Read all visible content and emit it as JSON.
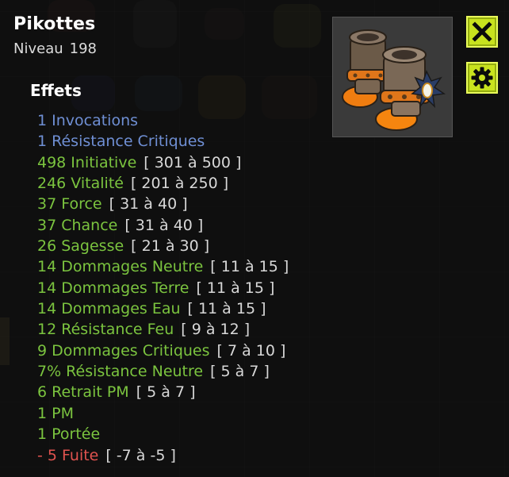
{
  "character": {
    "name": "Pikottes",
    "level_label": "Niveau",
    "level_value": "198"
  },
  "effects_title": "Effets",
  "effects": [
    {
      "text": "1 Invocations",
      "range": "",
      "color": "blue"
    },
    {
      "text": "1 Résistance Critiques",
      "range": "",
      "color": "blue"
    },
    {
      "text": "498 Initiative",
      "range": "[ 301 à 500 ]",
      "color": "green"
    },
    {
      "text": "246 Vitalité",
      "range": "[ 201 à 250 ]",
      "color": "green"
    },
    {
      "text": "37 Force",
      "range": "[ 31 à 40 ]",
      "color": "green"
    },
    {
      "text": "37 Chance",
      "range": "[ 31 à 40 ]",
      "color": "green"
    },
    {
      "text": "26 Sagesse",
      "range": "[ 21 à 30 ]",
      "color": "green"
    },
    {
      "text": "14 Dommages Neutre",
      "range": "[ 11 à 15 ]",
      "color": "green"
    },
    {
      "text": "14 Dommages Terre",
      "range": "[ 11 à 15 ]",
      "color": "green"
    },
    {
      "text": "14 Dommages Eau",
      "range": "[ 11 à 15 ]",
      "color": "green"
    },
    {
      "text": "12 Résistance Feu",
      "range": "[ 9 à 12 ]",
      "color": "green"
    },
    {
      "text": "9 Dommages Critiques",
      "range": "[ 7 à 10 ]",
      "color": "green"
    },
    {
      "text": "7% Résistance Neutre",
      "range": "[ 5 à 7 ]",
      "color": "green"
    },
    {
      "text": "6 Retrait PM",
      "range": "[ 5 à 7 ]",
      "color": "green"
    },
    {
      "text": "1 PM",
      "range": "",
      "color": "green"
    },
    {
      "text": "1 Portée",
      "range": "",
      "color": "green"
    },
    {
      "text": "- 5 Fuite",
      "range": "[ -7 à -5 ]",
      "color": "red"
    }
  ],
  "item": {
    "icon": "boots-icon"
  },
  "buttons": {
    "close_icon": "close-icon",
    "settings_icon": "gear-icon"
  },
  "colors": {
    "blue": "#6f8fd4",
    "green": "#7bc43f",
    "red": "#e0534f",
    "button": "#c8e21e"
  }
}
